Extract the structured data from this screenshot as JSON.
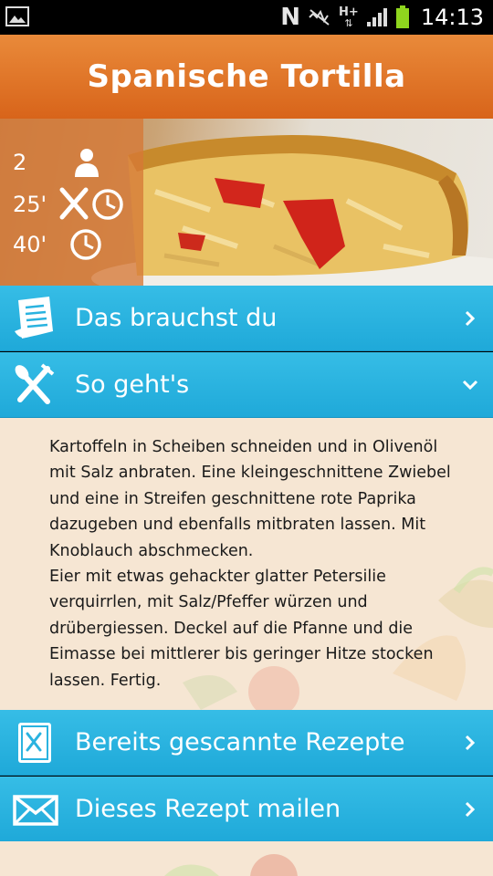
{
  "status_bar": {
    "time": "14:13",
    "network_label": "H+",
    "icons": [
      "gallery-icon",
      "nfc-icon",
      "mute-icon",
      "data-icon",
      "signal-icon",
      "battery-icon"
    ]
  },
  "header": {
    "title": "Spanische Tortilla"
  },
  "recipe_meta": {
    "servings": "2",
    "prep_time": "25'",
    "total_time": "40'"
  },
  "menu": {
    "ingredients_label": "Das brauchst du",
    "steps_label": "So geht's",
    "scanned_label": "Bereits gescannte Rezepte",
    "mail_label": "Dieses Rezept mailen"
  },
  "instructions": "Kartoffeln in Scheiben schneiden und in Olivenöl mit Salz anbraten. Eine kleingeschnittene Zwiebel und eine in Streifen geschnittene rote Paprika dazugeben und ebenfalls mitbraten lassen. Mit Knoblauch abschmecken.\nEier mit etwas gehackter glatter Petersilie verquirrlen, mit Salz/Pfeffer würzen und drübergiessen. Deckel auf die Pfanne und die Eimasse bei mittlerer bis geringer Hitze stocken lassen. Fertig.",
  "colors": {
    "header": "#e07a2c",
    "menu_bar": "#2ab3e0",
    "content_bg": "#f6e6d3"
  }
}
